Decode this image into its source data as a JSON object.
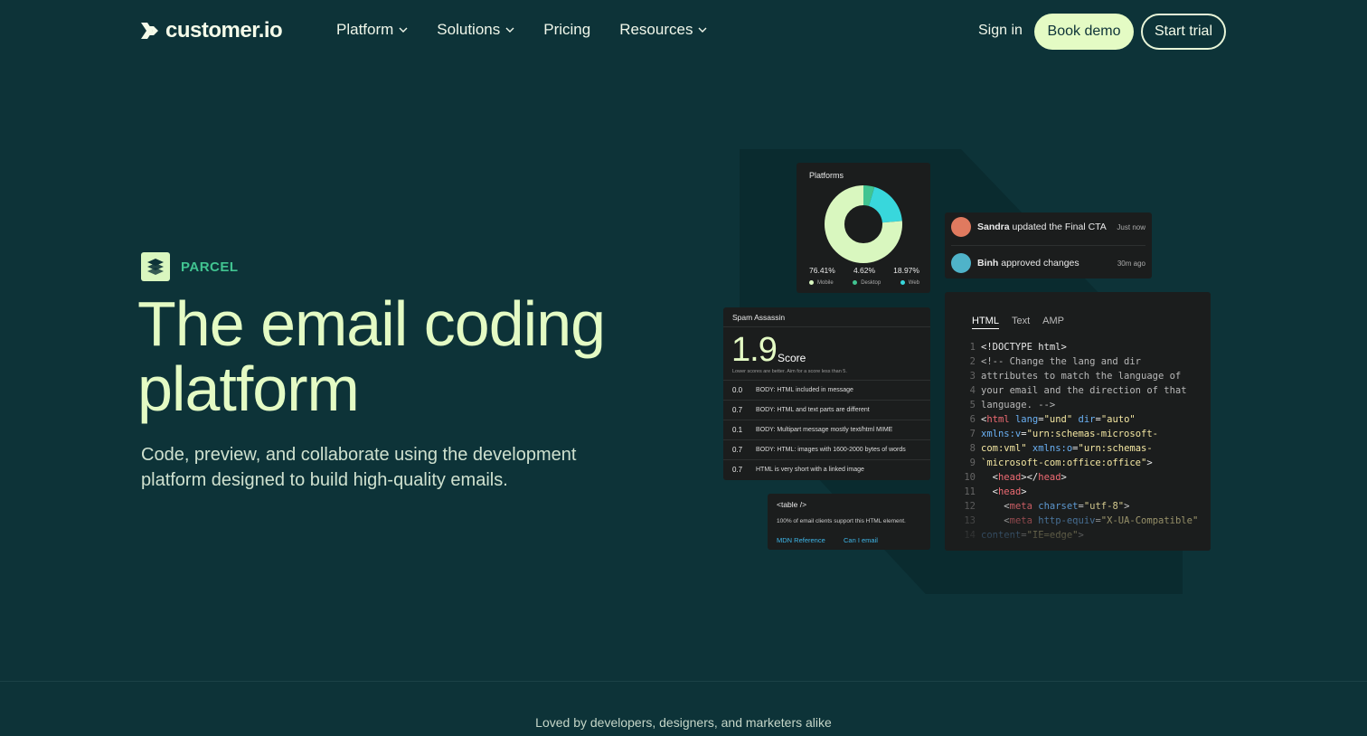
{
  "nav": {
    "brand": "customer.io",
    "links": [
      {
        "label": "Platform",
        "dropdown": true
      },
      {
        "label": "Solutions",
        "dropdown": true
      },
      {
        "label": "Pricing",
        "dropdown": false
      },
      {
        "label": "Resources",
        "dropdown": true
      }
    ],
    "sign_in": "Sign in",
    "book_demo": "Book demo",
    "start_trial": "Start trial"
  },
  "hero": {
    "eyebrow": "PARCEL",
    "title_line1": "The email coding",
    "title_line2": "platform",
    "subtitle": "Code, preview, and collaborate using the development platform designed to build high-quality emails."
  },
  "platforms_card": {
    "title": "Platforms",
    "slices": [
      {
        "label": "Mobile",
        "value": "76.41%",
        "pct": 76.41,
        "color": "#d9f7bf"
      },
      {
        "label": "Desktop",
        "value": "4.62%",
        "pct": 4.62,
        "color": "#41c491"
      },
      {
        "label": "Web",
        "value": "18.97%",
        "pct": 18.97,
        "color": "#38d7dc"
      }
    ]
  },
  "activity": [
    {
      "name": "Sandra",
      "action": " updated the Final CTA",
      "time": "Just now",
      "avatar_color": "#e07a5f"
    },
    {
      "name": "Binh",
      "action": " approved changes",
      "time": "30m ago",
      "avatar_color": "#4fb3c9"
    }
  ],
  "spam": {
    "title": "Spam Assassin",
    "score": "1.9",
    "score_label": "Score",
    "note": "Lower scores are better. Aim for a score less than 5.",
    "rows": [
      {
        "value": "0.0",
        "text": "BODY: HTML included in message"
      },
      {
        "value": "0.7",
        "text": "BODY: HTML and text parts are different"
      },
      {
        "value": "0.1",
        "text": "BODY: Multipart  message mostly text/html MIME"
      },
      {
        "value": "0.7",
        "text": "BODY: HTML: images with 1600-2000 bytes of words"
      },
      {
        "value": "0.7",
        "text": "HTML is very short with a linked image"
      }
    ]
  },
  "reference": {
    "tag": "<table />",
    "desc": "100% of email clients support this HTML element.",
    "link1": "MDN Reference",
    "link2": "Can I email"
  },
  "code": {
    "tabs": [
      "HTML",
      "Text",
      "AMP"
    ],
    "active_tab": "HTML"
  },
  "footer": {
    "loved": "Loved by developers, designers, and marketers alike"
  }
}
